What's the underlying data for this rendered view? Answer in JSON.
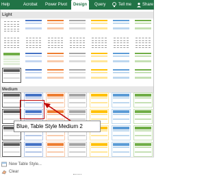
{
  "ribbon": {
    "tabs": [
      {
        "label": "Help",
        "active": false
      },
      {
        "label": "Acrobat",
        "active": false
      },
      {
        "label": "Power Pivot",
        "active": false
      },
      {
        "label": "Design",
        "active": true
      },
      {
        "label": "Query",
        "active": false
      }
    ],
    "tell_me_label": "Tell me",
    "share_label": "Share",
    "brand_color": "#217346"
  },
  "gallery": {
    "sections": [
      {
        "label": "Light"
      },
      {
        "label": "Medium"
      }
    ],
    "selected_style": "Blue, Table Style Medium 2",
    "tooltip": "Blue, Table Style Medium 2",
    "accent_palette": [
      "#7f7f7f",
      "#4472c4",
      "#ed7d31",
      "#a5a5a5",
      "#ffc000",
      "#5b9bd5",
      "#70ad47"
    ]
  },
  "footer": {
    "new_style_label": "New Table Style...",
    "clear_label": "Clear"
  }
}
